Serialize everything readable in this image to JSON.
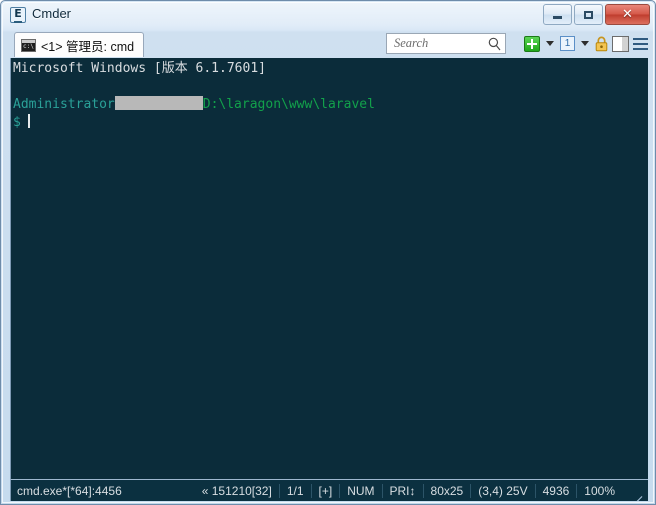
{
  "window": {
    "title": "Cmder",
    "app_icon": "cmder-monitor-icon",
    "controls": {
      "minimize_label": "Minimize",
      "maximize_label": "Maximize",
      "close_label": "Close"
    }
  },
  "tabbar": {
    "tabs": [
      {
        "icon": "console-icon",
        "label": "<1> 管理员: cmd",
        "active": true
      }
    ],
    "search": {
      "placeholder": "Search",
      "value": "",
      "icon": "search-icon"
    },
    "tools": [
      {
        "name": "new-console-button",
        "icon": "green-plus-icon",
        "label": "New console"
      },
      {
        "name": "new-console-dropdown",
        "icon": "chevron-down-icon",
        "label": "New console options"
      },
      {
        "name": "active-console-button",
        "icon": "console-number-icon",
        "label": "1"
      },
      {
        "name": "active-console-dropdown",
        "icon": "chevron-down-icon",
        "label": "Console list"
      },
      {
        "name": "admin-lock-button",
        "icon": "lock-icon",
        "label": "Elevated"
      },
      {
        "name": "split-pane-button",
        "icon": "split-pane-icon",
        "label": "Split pane"
      },
      {
        "name": "main-menu-button",
        "icon": "hamburger-menu-icon",
        "label": "Menu"
      }
    ]
  },
  "terminal": {
    "lines": [
      {
        "type": "plain",
        "text": "Microsoft Windows [版本 6.1.7601]",
        "color": "white"
      },
      {
        "type": "blank",
        "text": ""
      },
      {
        "type": "prompt",
        "user": "Administrator",
        "redacted": true,
        "path": "D:\\laragon\\www\\laravel"
      },
      {
        "type": "input",
        "symbol": "$",
        "value": ""
      }
    ],
    "line1": "Microsoft Windows [版本 6.1.7601]",
    "prompt_user": "Administrator",
    "prompt_path": "D:\\laragon\\www\\laravel",
    "prompt_symbol": "$",
    "input_value": "",
    "colors": {
      "background": "#0b2c3a",
      "text": "#d9dde0",
      "user": "#2aa198",
      "path": "#12a14b",
      "cursor": "#e6eaec",
      "redaction": "#b8b8b8"
    }
  },
  "statusbar": {
    "process": "cmd.exe*[*64]:4456",
    "cells": [
      "« 151210[32]",
      "1/1",
      "[+]",
      "NUM",
      "PRI↕",
      "80x25",
      "(3,4) 25V",
      "4936",
      "100%"
    ],
    "resize_grip": "resize-grip-icon"
  }
}
